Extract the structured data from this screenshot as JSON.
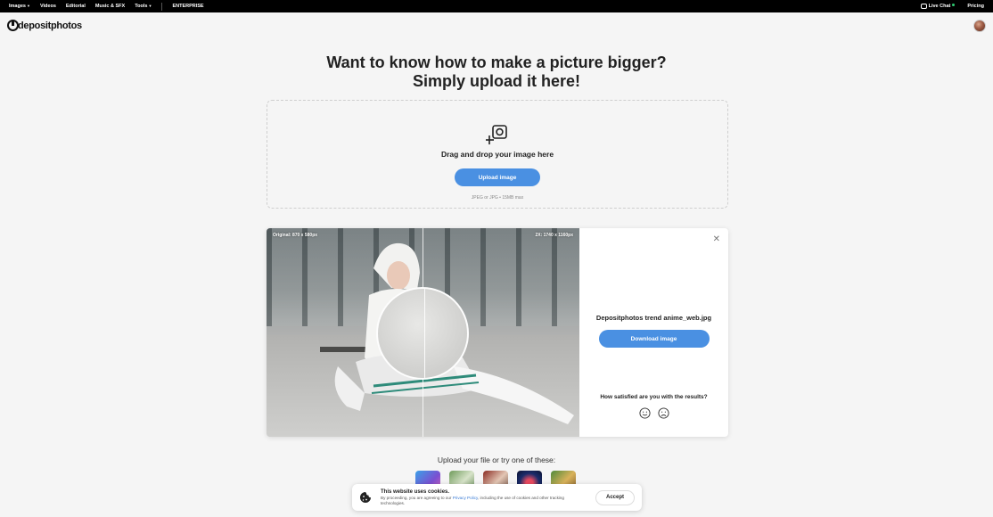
{
  "topbar": {
    "nav": [
      {
        "label": "Images",
        "dropdown": true
      },
      {
        "label": "Videos",
        "dropdown": false
      },
      {
        "label": "Editorial",
        "dropdown": false
      },
      {
        "label": "Music & SFX",
        "dropdown": false
      },
      {
        "label": "Tools",
        "dropdown": true
      }
    ],
    "enterprise": "ENTERPRISE",
    "live_chat": "Live Chat",
    "pricing": "Pricing"
  },
  "header": {
    "logo_text": "depositphotos",
    "avatar_icon": "user-avatar"
  },
  "hero": {
    "title_line1": "Want to know how to make a picture bigger?",
    "title_line2": "Simply upload it here!"
  },
  "dropzone": {
    "icon": "add-image-icon",
    "drag_text": "Drag and drop your image here",
    "upload_button": "Upload image",
    "hint": "JPEG or JPG • 15MB max"
  },
  "preview": {
    "original_label": "Original: 870 x 580px",
    "upscaled_label": "2X: 1740 x 1160px",
    "filename": "Depositphotos trend anime_web.jpg",
    "download_button": "Download image",
    "satisfaction_question": "How satisfied are you with the results?",
    "close_icon": "close-icon",
    "faces": [
      "smile-icon",
      "frown-icon"
    ]
  },
  "samples": {
    "prompt": "Upload your file or try one of these:",
    "count_visible": 5
  },
  "cookie_banner": {
    "title": "This website uses cookies.",
    "body_pre": "By proceeding, you are agreeing to our ",
    "link": "Privacy Policy",
    "body_post": ", including the use of cookies and other tracking technologies.",
    "accept": "Accept"
  },
  "colors": {
    "accent": "#4a90e2",
    "topbar": "#000000",
    "background": "#f5f5f5",
    "online": "#2ecc71"
  }
}
